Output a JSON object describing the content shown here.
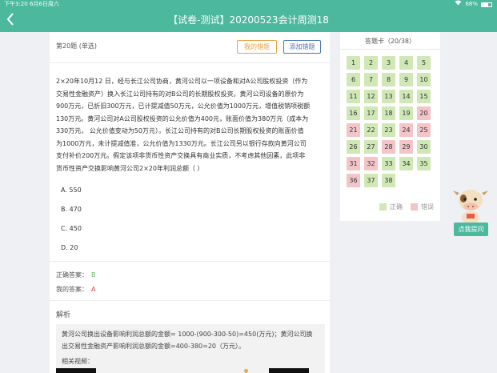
{
  "status_bar": {
    "time": "下午3:20",
    "date": "6月6日周六",
    "battery": "68%",
    "battery_level": 0.68
  },
  "nav": {
    "back_icon": "chevron-left-icon",
    "title": "【试卷-测试】20200523会计周测18"
  },
  "question": {
    "header": "第20题 (单选)",
    "my_mistakes_label": "我的错题",
    "add_mistake_label": "添加错题",
    "lines": [
      "2×20年10月12 日，经与长江公司协商，黄河公司以一项设备和对A公司股权投资（作为",
      "交易性金融资产）换入长江公司持有的对B公司的长期股权投资。黄河公司设备的原价为",
      "900万元，已折旧300万元，已计提减值50万元，公允价值为1000万元，增值税销项税额",
      "130万元。黄河公司对A公司股权投资的公允价值为400元，账面价值为380万元（成本为",
      "330万元，  公允价值变动为50万元）。长江公司持有的对B公司长期股权投资的账面价值",
      "为1000万元，未计提减值准，公允价值为1330万元。长江公司另以银行存款向黄河公司",
      "支付补价200万元。假定该项非货币性资产交换具有商业实质，不考虑其他因素，此项非",
      "货币性资产交换影响黄河公司2×20年利润总额（ ）"
    ],
    "options": [
      "A. 550",
      "B. 470",
      "C. 450",
      "D. 20"
    ],
    "correct_label": "正确答案：",
    "correct_value": "B",
    "my_label": "我的答案：",
    "my_value": "A"
  },
  "analysis": {
    "title": "解析",
    "lines": [
      "黄河公司换出设备影响利润总额的金额= 1000-(900-300-50)=450(万元)；黄河公司换",
      "出交易性金融资产影响利润总额的金额=400-380=20（万元）。"
    ],
    "video_label": "相关视频："
  },
  "answer_card": {
    "title": "答题卡（20/38）",
    "cells": [
      {
        "n": "1",
        "s": "correct"
      },
      {
        "n": "2",
        "s": "correct"
      },
      {
        "n": "3",
        "s": "correct"
      },
      {
        "n": "4",
        "s": "correct"
      },
      {
        "n": "5",
        "s": "correct"
      },
      {
        "n": "6",
        "s": "correct"
      },
      {
        "n": "7",
        "s": "correct"
      },
      {
        "n": "8",
        "s": "correct"
      },
      {
        "n": "9",
        "s": "correct"
      },
      {
        "n": "10",
        "s": "correct"
      },
      {
        "n": "11",
        "s": "correct"
      },
      {
        "n": "12",
        "s": "correct"
      },
      {
        "n": "13",
        "s": "correct"
      },
      {
        "n": "14",
        "s": "correct"
      },
      {
        "n": "15",
        "s": "correct"
      },
      {
        "n": "16",
        "s": "correct"
      },
      {
        "n": "17",
        "s": "correct"
      },
      {
        "n": "18",
        "s": "correct"
      },
      {
        "n": "19",
        "s": "correct"
      },
      {
        "n": "20",
        "s": "wrong"
      },
      {
        "n": "21",
        "s": "wrong"
      },
      {
        "n": "22",
        "s": "correct"
      },
      {
        "n": "23",
        "s": "correct"
      },
      {
        "n": "24",
        "s": "wrong"
      },
      {
        "n": "25",
        "s": "wrong"
      },
      {
        "n": "26",
        "s": "correct"
      },
      {
        "n": "27",
        "s": "correct"
      },
      {
        "n": "28",
        "s": "wrong"
      },
      {
        "n": "29",
        "s": "wrong"
      },
      {
        "n": "30",
        "s": "correct"
      },
      {
        "n": "31",
        "s": "wrong"
      },
      {
        "n": "32",
        "s": "wrong"
      },
      {
        "n": "33",
        "s": "correct"
      },
      {
        "n": "34",
        "s": "correct"
      },
      {
        "n": "35",
        "s": "correct"
      },
      {
        "n": "36",
        "s": "wrong"
      },
      {
        "n": "37",
        "s": "correct"
      },
      {
        "n": "38",
        "s": "correct"
      }
    ],
    "legend_correct": "正确",
    "legend_wrong": "错误"
  },
  "assistant": {
    "mascot_icon": "cow-mascot-icon",
    "ask_label": "点我提问"
  },
  "colors": {
    "accent": "#4cb89d",
    "correct": "#cfe8b5",
    "wrong": "#f3c5c8",
    "orange": "#e8a23c",
    "blue": "#4a74b8",
    "red": "#e23b3b",
    "green": "#5cb85c"
  }
}
